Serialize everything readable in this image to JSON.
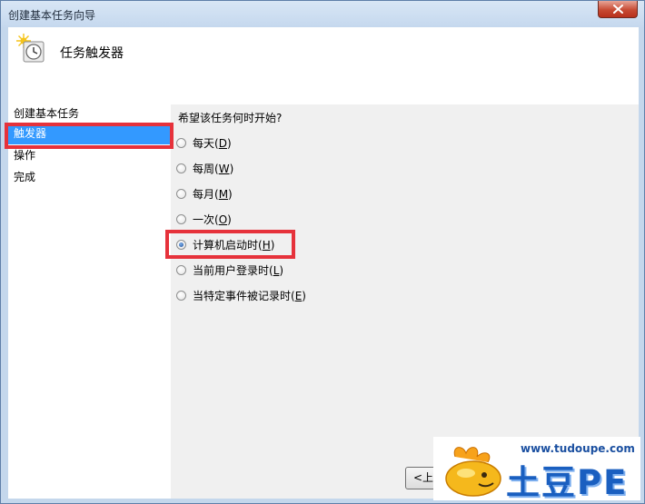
{
  "window": {
    "title": "创建基本任务向导"
  },
  "header": {
    "title": "任务触发器",
    "icon": "clock-icon"
  },
  "steps": [
    {
      "label": "创建基本任务"
    },
    {
      "label": "触发器"
    },
    {
      "label": "操作"
    },
    {
      "label": "完成"
    }
  ],
  "selected_step": "触发器",
  "content": {
    "question": "希望该任务何时开始?",
    "options": [
      {
        "text": "每天(",
        "key": "D",
        "suffix": ")"
      },
      {
        "text": "每周(",
        "key": "W",
        "suffix": ")"
      },
      {
        "text": "每月(",
        "key": "M",
        "suffix": ")"
      },
      {
        "text": "一次(",
        "key": "O",
        "suffix": ")"
      },
      {
        "text": "计算机启动时(",
        "key": "H",
        "suffix": ")"
      },
      {
        "text": "当前用户登录时(",
        "key": "L",
        "suffix": ")"
      },
      {
        "text": "当特定事件被记录时(",
        "key": "E",
        "suffix": ")"
      }
    ],
    "selected_option": "计算机启动时"
  },
  "buttons": {
    "back_label": "<上"
  },
  "watermark": {
    "url": "www.tudoupe.com",
    "brand": "土豆PE"
  },
  "colors": {
    "selection": "#3399ff",
    "highlight": "#e6323b"
  }
}
